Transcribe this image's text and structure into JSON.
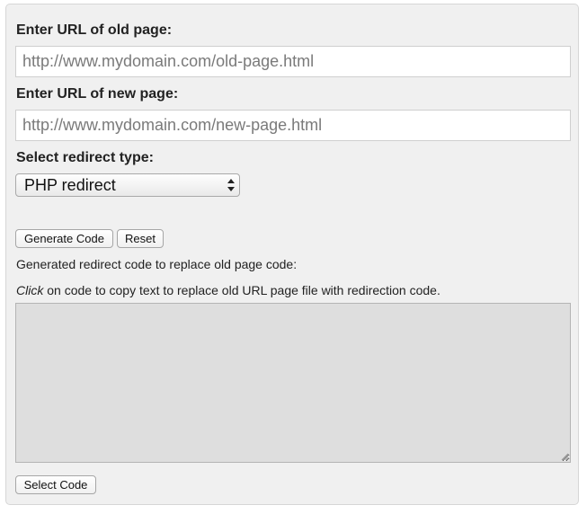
{
  "form": {
    "old_url_label": "Enter URL of old page:",
    "old_url_placeholder": "http://www.mydomain.com/old-page.html",
    "new_url_label": "Enter URL of new page:",
    "new_url_placeholder": "http://www.mydomain.com/new-page.html",
    "redirect_type_label": "Select redirect type:",
    "redirect_type_selected": "PHP redirect"
  },
  "buttons": {
    "generate": "Generate Code",
    "reset": "Reset",
    "select_code": "Select Code"
  },
  "output": {
    "heading": "Generated redirect code to replace old page code:",
    "hint_emphasis": "Click",
    "hint_rest": " on code to copy text to replace old URL page file with redirection code.",
    "code": ""
  },
  "icons": {
    "select_arrows": "up-down-arrows-icon",
    "resize_grip": "resize-grip-icon"
  }
}
